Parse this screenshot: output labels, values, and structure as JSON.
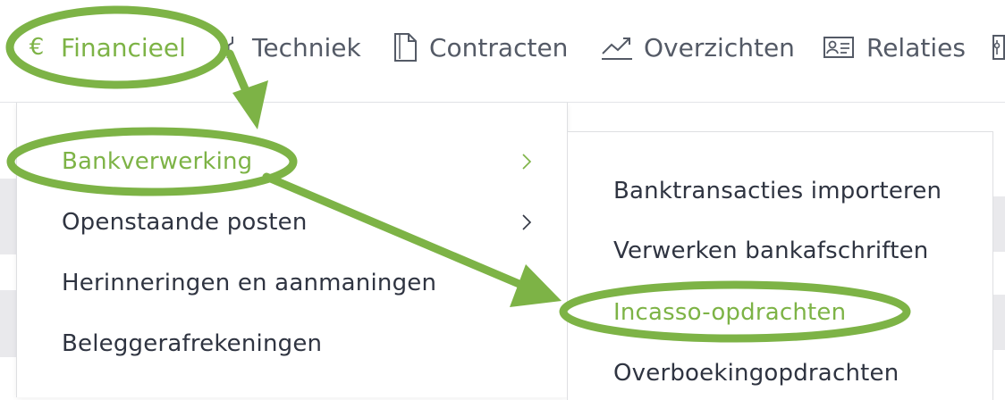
{
  "nav": {
    "items": [
      {
        "label": "Financieel",
        "icon": "euro-icon",
        "active": true
      },
      {
        "label": "Techniek",
        "icon": "wrench-icon",
        "active": false
      },
      {
        "label": "Contracten",
        "icon": "document-icon",
        "active": false
      },
      {
        "label": "Overzichten",
        "icon": "trend-chart-icon",
        "active": false
      },
      {
        "label": "Relaties",
        "icon": "contact-card-icon",
        "active": false
      }
    ]
  },
  "menu": {
    "items": [
      {
        "label": "Bankverwerking",
        "has_submenu": true,
        "active": true
      },
      {
        "label": "Openstaande posten",
        "has_submenu": true,
        "active": false
      },
      {
        "label": "Herinneringen en aanmaningen",
        "has_submenu": true,
        "active": false
      },
      {
        "label": "Beleggerafrekeningen",
        "has_submenu": false,
        "active": false
      }
    ]
  },
  "submenu": {
    "items": [
      {
        "label": "Banktransacties importeren",
        "active": false
      },
      {
        "label": "Verwerken bankafschriften",
        "active": false
      },
      {
        "label": "Incasso-opdrachten",
        "active": true
      },
      {
        "label": "Overboekingopdrachten",
        "active": false
      }
    ]
  },
  "colors": {
    "accent": "#7db346",
    "text": "#2f3441",
    "nav_text": "#545a66",
    "annotation": "#7db346"
  },
  "euro_symbol": "€"
}
